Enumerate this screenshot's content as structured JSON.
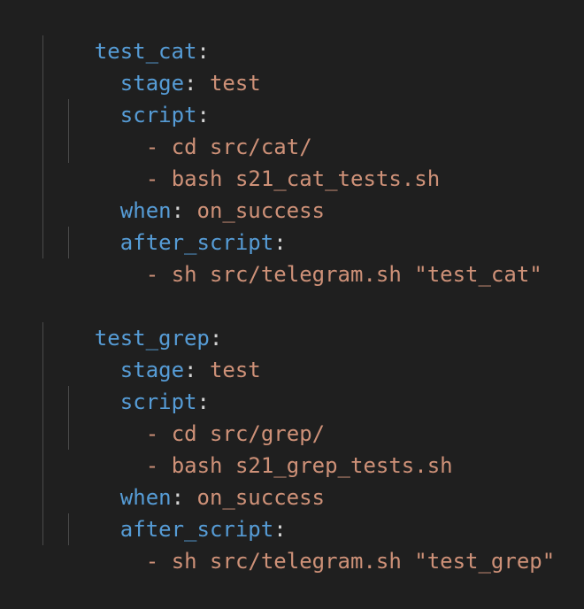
{
  "blocks": [
    {
      "name": "test_cat",
      "stage_key": "stage",
      "stage_value": "test",
      "script_key": "script",
      "script_items": [
        "cd src/cat/",
        "bash s21_cat_tests.sh"
      ],
      "when_key": "when",
      "when_value": "on_success",
      "after_script_key": "after_script",
      "after_script_items": [
        "sh src/telegram.sh \"test_cat\""
      ]
    },
    {
      "name": "test_grep",
      "stage_key": "stage",
      "stage_value": "test",
      "script_key": "script",
      "script_items": [
        "cd src/grep/",
        "bash s21_grep_tests.sh"
      ],
      "when_key": "when",
      "when_value": "on_success",
      "after_script_key": "after_script",
      "after_script_items": [
        "sh src/telegram.sh \"test_grep\""
      ]
    }
  ],
  "syntax": {
    "colon": ":",
    "dash": "- "
  },
  "colors": {
    "background": "#1f1f1f",
    "key": "#569cd6",
    "value": "#ce9178",
    "punctuation": "#d4d4d4",
    "indent_guide": "#4a4a4a"
  }
}
